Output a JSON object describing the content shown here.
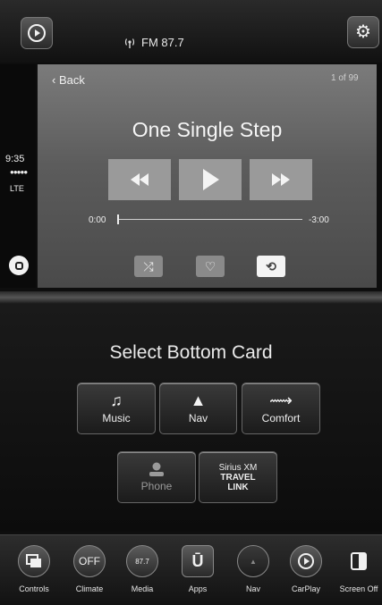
{
  "topbar": {
    "carplay_icon": "carplay-icon",
    "radio_icon": "radio-signal-icon",
    "station": "FM 87.7",
    "settings_icon": "gear-icon"
  },
  "status": {
    "time": "9:35",
    "signal": "●●●●●",
    "network": "LTE"
  },
  "player": {
    "back_label": "Back",
    "page_count": "1 of 99",
    "song_title": "One Single Step",
    "elapsed": "0:00",
    "remaining": "-3:00",
    "progress": 0
  },
  "cards": {
    "title": "Select Bottom Card",
    "items": [
      {
        "label": "Music",
        "icon": "music-note-icon"
      },
      {
        "label": "Nav",
        "icon": "navigation-arrow-icon"
      },
      {
        "label": "Comfort",
        "icon": "seat-climate-icon"
      },
      {
        "label": "Phone",
        "icon": "person-icon"
      }
    ],
    "siriusxm": {
      "line1": "Sirius XM",
      "line2": "TRAVEL",
      "line3": "LINK"
    }
  },
  "dock": {
    "items": [
      {
        "label": "Controls",
        "icon": "controls-icon"
      },
      {
        "label": "Climate",
        "icon": "climate-off-icon",
        "badge": "OFF"
      },
      {
        "label": "Media",
        "icon": "media-icon",
        "badge": "87.7"
      },
      {
        "label": "Apps",
        "icon": "apps-icon"
      },
      {
        "label": "Nav",
        "icon": "nav-icon"
      },
      {
        "label": "CarPlay",
        "icon": "carplay-icon"
      },
      {
        "label": "Screen Off",
        "icon": "screen-off-icon"
      }
    ]
  },
  "colors": {
    "accent": "#ffffff",
    "panel": "#6a6a6a",
    "background": "#0e0e0e"
  }
}
